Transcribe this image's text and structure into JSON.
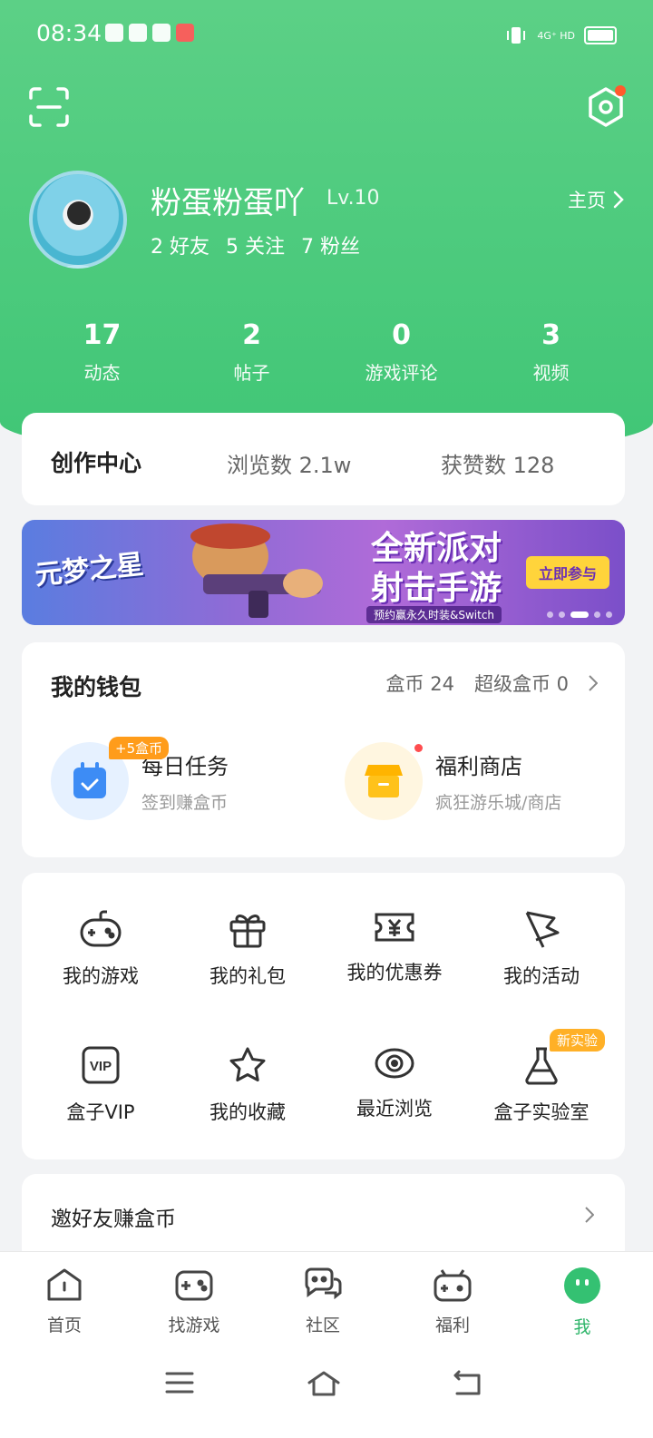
{
  "status_bar": {
    "time": "08:34",
    "network": "4G⁺ HD"
  },
  "profile": {
    "nickname": "粉蛋粉蛋吖",
    "level": "Lv.10",
    "homepage_label": "主页",
    "friends": "2 好友",
    "following": "5 关注",
    "fans": "7 粉丝"
  },
  "stats": [
    {
      "value": "17",
      "label": "动态"
    },
    {
      "value": "2",
      "label": "帖子"
    },
    {
      "value": "0",
      "label": "游戏评论"
    },
    {
      "value": "3",
      "label": "视频"
    }
  ],
  "creation": {
    "title": "创作中心",
    "views": "浏览数 2.1w",
    "likes": "获赞数 128"
  },
  "banner": {
    "logo": "元梦之星",
    "headline_1": "全新派对",
    "headline_2": "射击手游",
    "cta": "立即参与",
    "sub": "预约赢永久时装&Switch"
  },
  "wallet": {
    "title": "我的钱包",
    "coins": "盒币 24",
    "super_coins": "超级盒币 0",
    "daily_task": {
      "title": "每日任务",
      "subtitle": "签到赚盒币",
      "badge": "+5盒币"
    },
    "shop": {
      "title": "福利商店",
      "subtitle": "疯狂游乐城/商店"
    }
  },
  "grid": [
    {
      "label": "我的游戏"
    },
    {
      "label": "我的礼包"
    },
    {
      "label": "我的优惠券"
    },
    {
      "label": "我的活动"
    },
    {
      "label": "盒子VIP"
    },
    {
      "label": "我的收藏"
    },
    {
      "label": "最近浏览"
    },
    {
      "label": "盒子实验室",
      "badge": "新实验"
    }
  ],
  "invite": {
    "label": "邀好友赚盒币"
  },
  "tabs": [
    {
      "label": "首页"
    },
    {
      "label": "找游戏"
    },
    {
      "label": "社区"
    },
    {
      "label": "福利"
    },
    {
      "label": "我"
    }
  ],
  "colors": {
    "accent": "#2fb56a",
    "header": "#4ccb7d",
    "badge_orange": "#ff9c1a"
  }
}
